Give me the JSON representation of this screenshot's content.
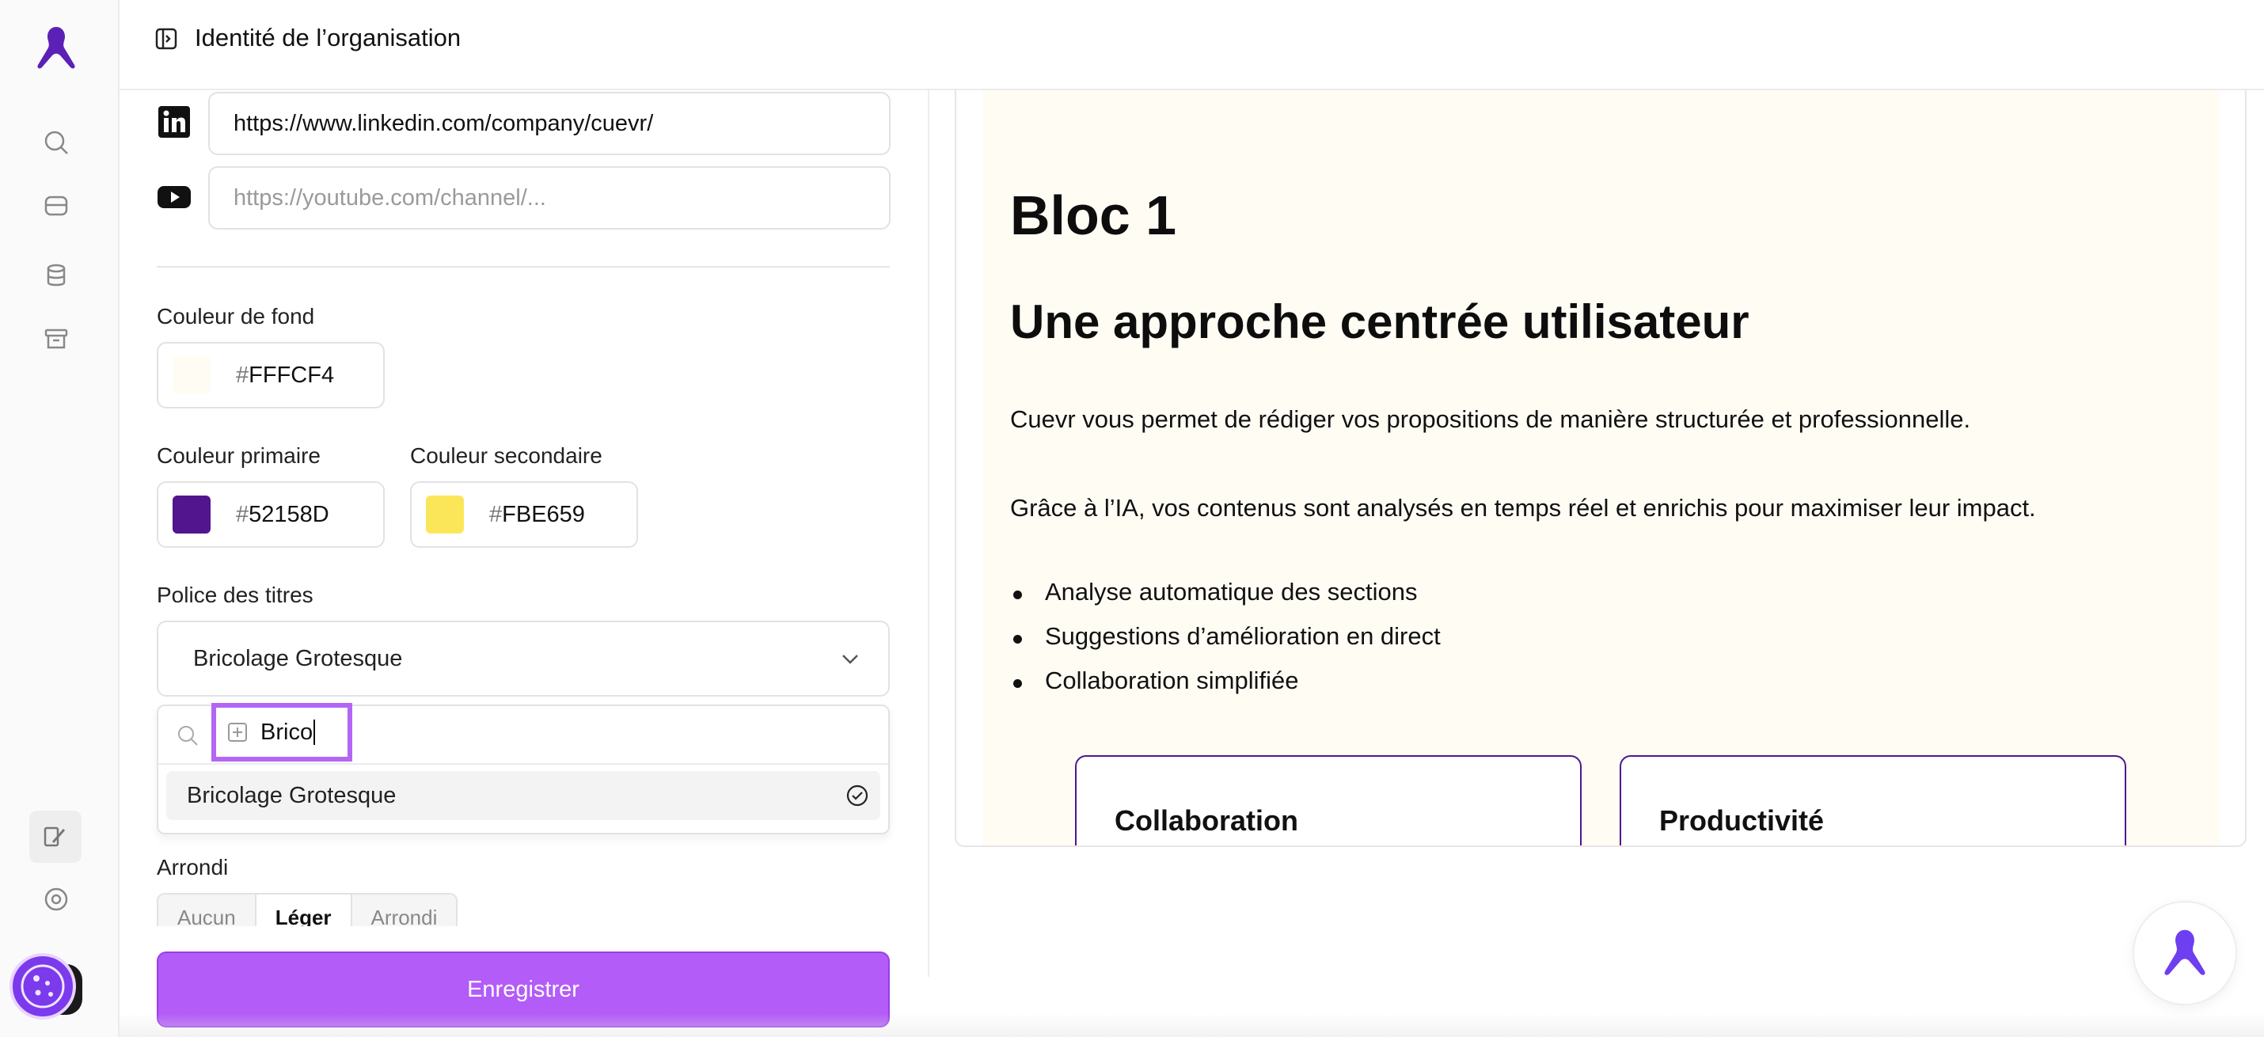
{
  "header": {
    "title": "Identité de l’organisation"
  },
  "socials": {
    "linkedin_value": "https://www.linkedin.com/company/cuevr/",
    "youtube_placeholder": "https://youtube.com/channel/..."
  },
  "colors": {
    "background_label": "Couleur de fond",
    "background_hex": "FFFCF4",
    "background_color": "#FFFCF4",
    "primary_label": "Couleur primaire",
    "primary_hex": "52158D",
    "primary_color": "#52158D",
    "secondary_label": "Couleur secondaire",
    "secondary_hex": "FBE659",
    "secondary_color": "#FBE659"
  },
  "font": {
    "label": "Police des titres",
    "selected": "Bricolage Grotesque",
    "search_query": "Brico",
    "options": [
      "Bricolage Grotesque"
    ]
  },
  "rounding": {
    "label": "Arrondi",
    "options": [
      "Aucun",
      "Léger",
      "Arrondi"
    ]
  },
  "save_label": "Enregistrer",
  "preview": {
    "h1": "Bloc 1",
    "h2": "Une approche centrée utilisateur",
    "paragraphs": [
      "Cuevr vous permet de rédiger vos propositions de manière structurée et professionnelle.",
      "Grâce à l’IA, vos contenus sont analysés en temps réel et enrichis pour maximiser leur impact."
    ],
    "bullets": [
      "Analyse automatique des sections",
      "Suggestions d’amélioration en direct",
      "Collaboration simplifiée"
    ],
    "cards": [
      "Collaboration",
      "Productivité"
    ]
  },
  "icons": {
    "sidebar": [
      "logo-icon",
      "search-icon",
      "inbox-icon",
      "database-icon",
      "archive-icon",
      "brush-icon",
      "help-circle-icon",
      "cookie-icon"
    ],
    "accent": "#b35cf8",
    "brand": "#5b21b6"
  }
}
